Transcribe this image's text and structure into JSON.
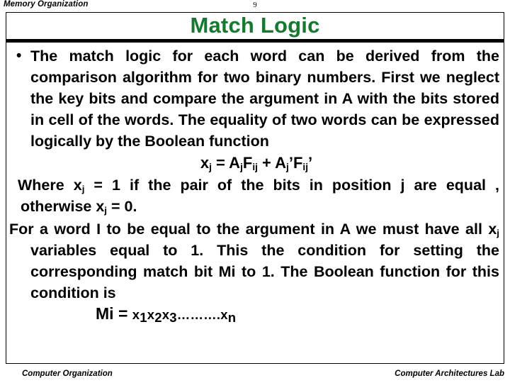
{
  "header": {
    "section_label": "Memory Organization",
    "page_number": "9"
  },
  "title": {
    "text": "Match Logic",
    "color": "#15792e"
  },
  "body": {
    "bullet_glyph": "•",
    "paragraph_1": "The match logic for each word can be derived from the comparison algorithm for two binary numbers.   First we neglect the key bits and compare the argument in A with the bits stored in cell of the words. The equality of two words can be expressed logically by the Boolean function",
    "formula_1": {
      "lhs_var": "x",
      "lhs_sub": "j",
      "eq": " = ",
      "t1_var": "A",
      "t1_sub": "j",
      "t2_var": "F",
      "t2_sub": "ij",
      "plus": " + ",
      "t3_var": "A",
      "t3_sub": "j",
      "t3_prime": "’",
      "t4_var": "F",
      "t4_sub": "ij",
      "t4_prime": "’"
    },
    "paragraph_2_a": "Where x",
    "paragraph_2_sub_a": "j",
    "paragraph_2_b": " = 1 if the pair of the bits in position j are equal , otherwise x",
    "paragraph_2_sub_b": "j",
    "paragraph_2_c": " = 0.",
    "paragraph_3_a": "For a word I to be equal to the argument in A we must have all x",
    "paragraph_3_sub": "j",
    "paragraph_3_b": " variables equal to 1. This the condition for setting the corresponding match bit Mi to 1. The Boolean function for this condition is",
    "formula_2": {
      "lhs": "Mi = ",
      "t1_var": "x",
      "t1_sub": "1",
      "t2_var": "x",
      "t2_sub": "2",
      "t3_var": "x",
      "t3_sub": "3",
      "dots": "……….",
      "t4_var": "x",
      "t4_sub": "n"
    }
  },
  "footer": {
    "left": "Computer Organization",
    "right": "Computer Architectures Lab"
  }
}
